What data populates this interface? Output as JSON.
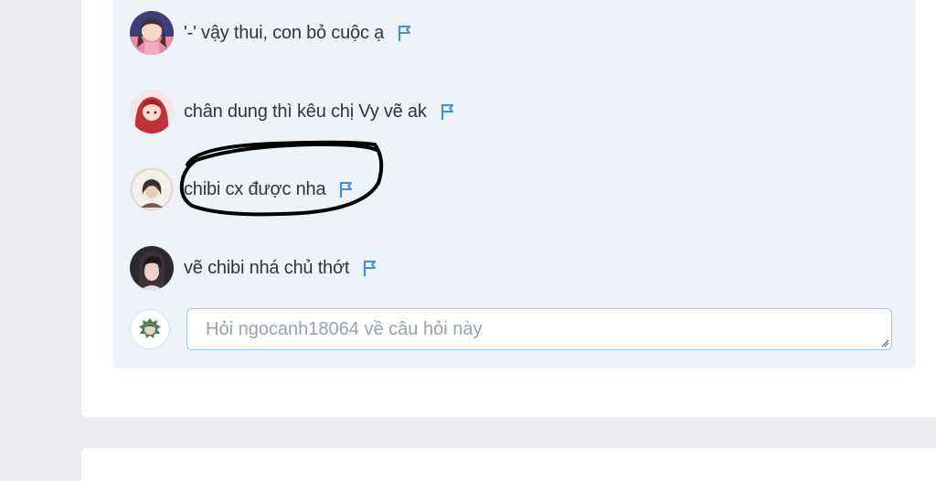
{
  "comments": [
    {
      "text": "'-' vậy thui, con bỏ cuộc ạ",
      "flag_icon": "flag-icon"
    },
    {
      "text": "chân dung thì kêu chị Vy vẽ ak",
      "flag_icon": "flag-icon"
    },
    {
      "text": "chibi cx được nha",
      "flag_icon": "flag-icon"
    },
    {
      "text": "vẽ chibi nhá chủ thớt",
      "flag_icon": "flag-icon"
    }
  ],
  "reply": {
    "placeholder": "Hỏi ngocanh18064 về câu hỏi này",
    "value": ""
  },
  "colors": {
    "flag": "#3d8fe0",
    "comments_bg": "#eef2f9",
    "page_bg": "#e9ebee",
    "input_border": "#a9c4e6"
  }
}
